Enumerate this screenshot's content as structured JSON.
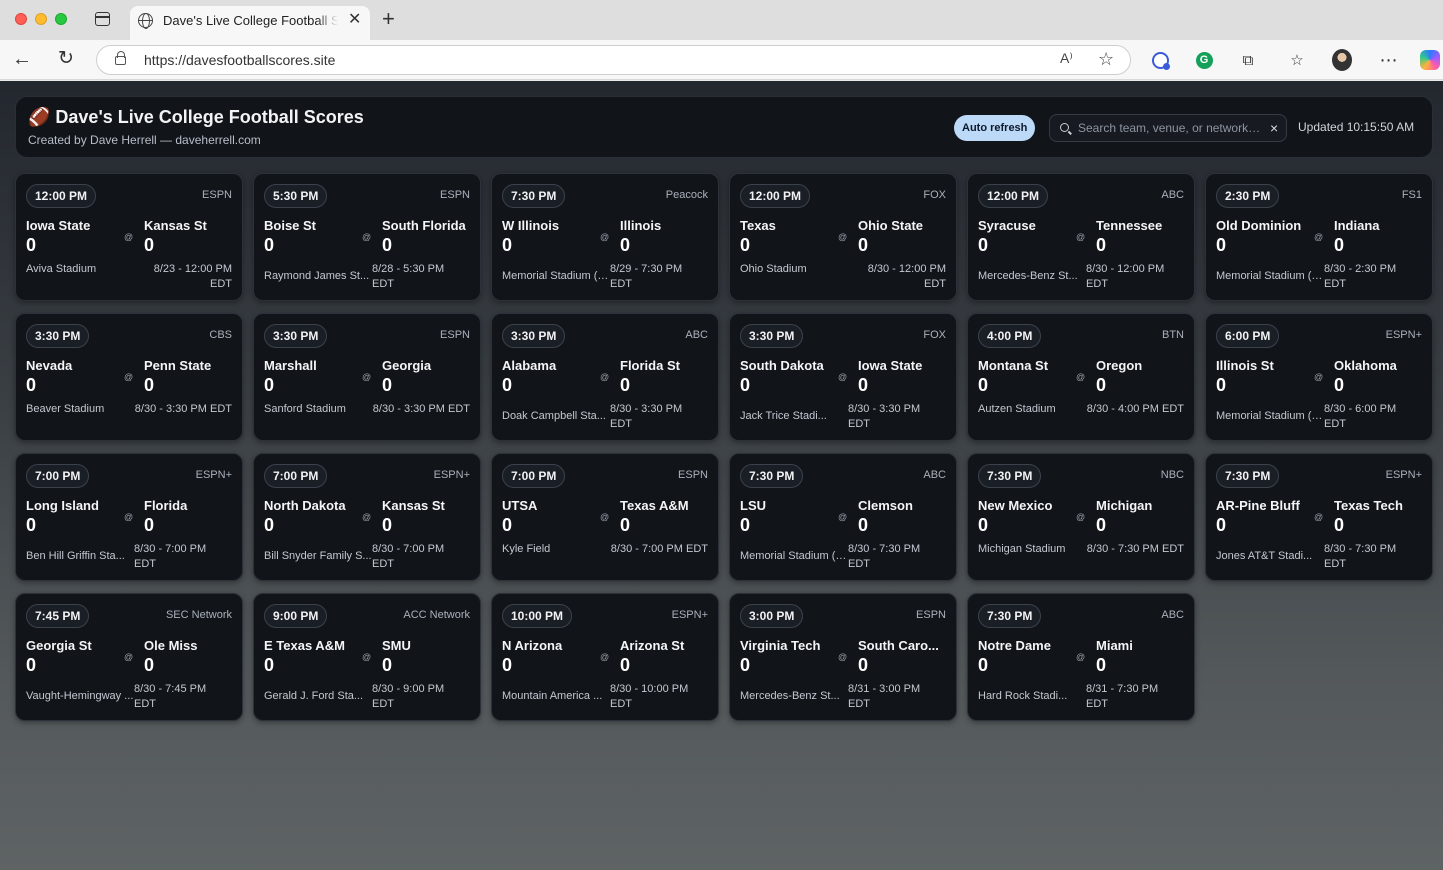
{
  "browser": {
    "tab_title": "Dave's Live College Football Scores",
    "url": "https://davesfootballscores.site",
    "read_aloud": "A⁾"
  },
  "header": {
    "title": "🏈 Dave's Live College Football Scores",
    "subtitle": "Created by Dave Herrell — daveherrell.com",
    "auto_refresh_label": "Auto refresh",
    "search_placeholder": "Search team, venue, or network…",
    "clear_label": "×",
    "updated": "Updated 10:15:50 AM"
  },
  "at_symbol": "@",
  "games": [
    {
      "time": "12:00 PM",
      "network": "ESPN",
      "away": "Iowa State",
      "home": "Kansas St",
      "away_score": "0",
      "home_score": "0",
      "venue": "Aviva Stadium",
      "datetime": "8/23 - 12:00 PM EDT"
    },
    {
      "time": "5:30 PM",
      "network": "ESPN",
      "away": "Boise St",
      "home": "South Florida",
      "away_score": "0",
      "home_score": "0",
      "venue": "Raymond James St...",
      "datetime": "8/28 - 5:30 PM EDT"
    },
    {
      "time": "7:30 PM",
      "network": "Peacock",
      "away": "W Illinois",
      "home": "Illinois",
      "away_score": "0",
      "home_score": "0",
      "venue": "Memorial Stadium (Ch...",
      "datetime": "8/29 - 7:30 PM EDT"
    },
    {
      "time": "12:00 PM",
      "network": "FOX",
      "away": "Texas",
      "home": "Ohio State",
      "away_score": "0",
      "home_score": "0",
      "venue": "Ohio Stadium",
      "datetime": "8/30 - 12:00 PM EDT"
    },
    {
      "time": "12:00 PM",
      "network": "ABC",
      "away": "Syracuse",
      "home": "Tennessee",
      "away_score": "0",
      "home_score": "0",
      "venue": "Mercedes-Benz St...",
      "datetime": "8/30 - 12:00 PM EDT"
    },
    {
      "time": "2:30 PM",
      "network": "FS1",
      "away": "Old Dominion",
      "home": "Indiana",
      "away_score": "0",
      "home_score": "0",
      "venue": "Memorial Stadium (Blo...",
      "datetime": "8/30 - 2:30 PM EDT"
    },
    {
      "time": "3:30 PM",
      "network": "CBS",
      "away": "Nevada",
      "home": "Penn State",
      "away_score": "0",
      "home_score": "0",
      "venue": "Beaver Stadium",
      "datetime": "8/30 - 3:30 PM EDT"
    },
    {
      "time": "3:30 PM",
      "network": "ESPN",
      "away": "Marshall",
      "home": "Georgia",
      "away_score": "0",
      "home_score": "0",
      "venue": "Sanford Stadium",
      "datetime": "8/30 - 3:30 PM EDT"
    },
    {
      "time": "3:30 PM",
      "network": "ABC",
      "away": "Alabama",
      "home": "Florida St",
      "away_score": "0",
      "home_score": "0",
      "venue": "Doak Campbell Sta...",
      "datetime": "8/30 - 3:30 PM EDT"
    },
    {
      "time": "3:30 PM",
      "network": "FOX",
      "away": "South Dakota",
      "home": "Iowa State",
      "away_score": "0",
      "home_score": "0",
      "venue": "Jack Trice Stadi...",
      "datetime": "8/30 - 3:30 PM EDT"
    },
    {
      "time": "4:00 PM",
      "network": "BTN",
      "away": "Montana St",
      "home": "Oregon",
      "away_score": "0",
      "home_score": "0",
      "venue": "Autzen Stadium",
      "datetime": "8/30 - 4:00 PM EDT"
    },
    {
      "time": "6:00 PM",
      "network": "ESPN+",
      "away": "Illinois St",
      "home": "Oklahoma",
      "away_score": "0",
      "home_score": "0",
      "venue": "Memorial Stadium (N...",
      "datetime": "8/30 - 6:00 PM EDT"
    },
    {
      "time": "7:00 PM",
      "network": "ESPN+",
      "away": "Long Island",
      "home": "Florida",
      "away_score": "0",
      "home_score": "0",
      "venue": "Ben Hill Griffin Sta...",
      "datetime": "8/30 - 7:00 PM EDT"
    },
    {
      "time": "7:00 PM",
      "network": "ESPN+",
      "away": "North Dakota",
      "home": "Kansas St",
      "away_score": "0",
      "home_score": "0",
      "venue": "Bill Snyder Family S...",
      "datetime": "8/30 - 7:00 PM EDT"
    },
    {
      "time": "7:00 PM",
      "network": "ESPN",
      "away": "UTSA",
      "home": "Texas A&M",
      "away_score": "0",
      "home_score": "0",
      "venue": "Kyle Field",
      "datetime": "8/30 - 7:00 PM EDT"
    },
    {
      "time": "7:30 PM",
      "network": "ABC",
      "away": "LSU",
      "home": "Clemson",
      "away_score": "0",
      "home_score": "0",
      "venue": "Memorial Stadium (Cl...",
      "datetime": "8/30 - 7:30 PM EDT"
    },
    {
      "time": "7:30 PM",
      "network": "NBC",
      "away": "New Mexico",
      "home": "Michigan",
      "away_score": "0",
      "home_score": "0",
      "venue": "Michigan Stadium",
      "datetime": "8/30 - 7:30 PM EDT"
    },
    {
      "time": "7:30 PM",
      "network": "ESPN+",
      "away": "AR-Pine Bluff",
      "home": "Texas Tech",
      "away_score": "0",
      "home_score": "0",
      "venue": "Jones AT&T Stadi...",
      "datetime": "8/30 - 7:30 PM EDT"
    },
    {
      "time": "7:45 PM",
      "network": "SEC Network",
      "away": "Georgia St",
      "home": "Ole Miss",
      "away_score": "0",
      "home_score": "0",
      "venue": "Vaught-Hemingway ...",
      "datetime": "8/30 - 7:45 PM EDT"
    },
    {
      "time": "9:00 PM",
      "network": "ACC Network",
      "away": "E Texas A&M",
      "home": "SMU",
      "away_score": "0",
      "home_score": "0",
      "venue": "Gerald J. Ford Sta...",
      "datetime": "8/30 - 9:00 PM EDT"
    },
    {
      "time": "10:00 PM",
      "network": "ESPN+",
      "away": "N Arizona",
      "home": "Arizona St",
      "away_score": "0",
      "home_score": "0",
      "venue": "Mountain America ...",
      "datetime": "8/30 - 10:00 PM EDT"
    },
    {
      "time": "3:00 PM",
      "network": "ESPN",
      "away": "Virginia Tech",
      "home": "South Caro...",
      "away_score": "0",
      "home_score": "0",
      "venue": "Mercedes-Benz St...",
      "datetime": "8/31 - 3:00 PM EDT"
    },
    {
      "time": "7:30 PM",
      "network": "ABC",
      "away": "Notre Dame",
      "home": "Miami",
      "away_score": "0",
      "home_score": "0",
      "venue": "Hard Rock Stadi...",
      "datetime": "8/31 - 7:30 PM EDT"
    }
  ]
}
